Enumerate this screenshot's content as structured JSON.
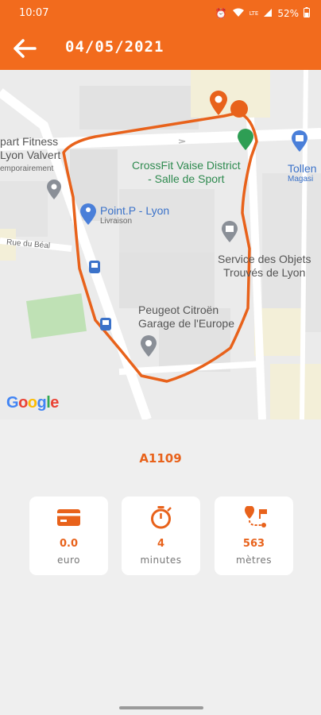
{
  "status_bar": {
    "time": "10:07",
    "network": "LTE",
    "battery": "52%"
  },
  "header": {
    "title": "04/05/2021"
  },
  "map": {
    "labels": {
      "gym_line1": "part Fitness",
      "gym_line2": "Lyon Valvert",
      "gym_line3": "emporairement",
      "crossfit_line1": "CrossFit Vaise District",
      "crossfit_line2": "- Salle de Sport",
      "tollens": "Tollen",
      "magasin": "Magasi",
      "pointp": "Point.P - Lyon",
      "livraison": "Livraison",
      "rue": "Rue du Béal",
      "service_line1": "Service des Objets",
      "service_line2": "Trouvés de Lyon",
      "peugeot_line1": "Peugeot Citroën",
      "peugeot_line2": "Garage de l'Europe"
    },
    "attribution": "Google",
    "route_color": "#e8621b"
  },
  "trip": {
    "vehicle_id": "A1109"
  },
  "stats": [
    {
      "icon": "credit-card-icon",
      "value": "0.0",
      "unit": "euro"
    },
    {
      "icon": "stopwatch-icon",
      "value": "4",
      "unit": "minutes"
    },
    {
      "icon": "route-icon",
      "value": "563",
      "unit": "mètres"
    }
  ],
  "colors": {
    "accent": "#f26b1d",
    "text_accent": "#e8621b"
  }
}
